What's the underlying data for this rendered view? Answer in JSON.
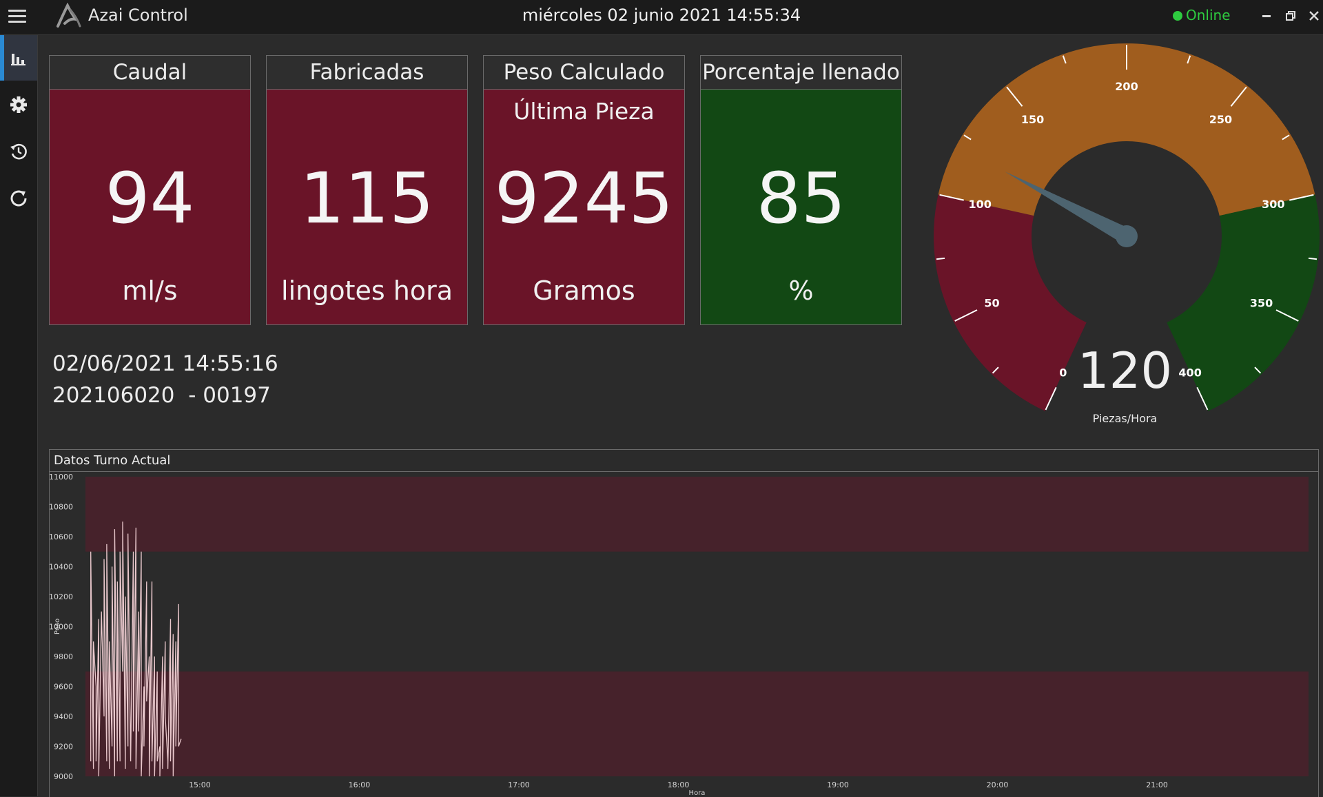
{
  "app": {
    "title": "Azai Control",
    "datetime": "miércoles 02 junio 2021 14:55:34",
    "status": "Online",
    "status_color": "#2ecc40"
  },
  "window_controls": {
    "icons": [
      "minimize-icon",
      "restore-icon",
      "close-icon"
    ]
  },
  "sidebar": {
    "items": [
      {
        "icon": "bar-chart-icon",
        "active": true
      },
      {
        "icon": "gear-icon",
        "active": false
      },
      {
        "icon": "history-icon",
        "active": false
      },
      {
        "icon": "refresh-icon",
        "active": false
      }
    ]
  },
  "tiles": [
    {
      "title": "Caudal",
      "subtitle": "",
      "value": "94",
      "unit": "ml/s",
      "color": "#6a1428"
    },
    {
      "title": "Fabricadas",
      "subtitle": "",
      "value": "115",
      "unit": "lingotes hora",
      "color": "#6a1428"
    },
    {
      "title": "Peso Calculado",
      "subtitle": "Última Pieza",
      "value": "9245",
      "unit": "Gramos",
      "color": "#6a1428"
    },
    {
      "title": "Porcentaje llenado",
      "subtitle": "",
      "value": "85",
      "unit": "%",
      "color": "#124814"
    }
  ],
  "info": {
    "timestamp": "02/06/2021 14:55:16",
    "lot": "202106020  - 00197"
  },
  "gauge": {
    "value": "120",
    "needle_value": 120,
    "unit": "Piezas/Hora",
    "min": 0,
    "max": 400,
    "major_labels": [
      "0",
      "50",
      "100",
      "150",
      "200",
      "250",
      "300",
      "350",
      "400"
    ],
    "bands": [
      {
        "from": 0,
        "to": 100,
        "color": "#6a1428"
      },
      {
        "from": 100,
        "to": 300,
        "color": "#a05d1e"
      },
      {
        "from": 300,
        "to": 400,
        "color": "#124814"
      }
    ]
  },
  "chart_panel": {
    "title": "Datos Turno Actual"
  },
  "chart_data": {
    "type": "line",
    "title": "Datos Turno Actual",
    "xlabel": "Hora",
    "ylabel": "Peso",
    "ylim": [
      9000,
      11000
    ],
    "xlim": [
      "14:17",
      "21:57"
    ],
    "yticks": [
      "11000",
      "10800",
      "10600",
      "10400",
      "10200",
      "10000",
      "9800",
      "9600",
      "9400",
      "9200",
      "9000"
    ],
    "xticks": [
      "15:00",
      "16:00",
      "17:00",
      "18:00",
      "19:00",
      "20:00",
      "21:00"
    ],
    "bands": [
      {
        "from": 10500,
        "to": 11000,
        "color": "#46222b"
      },
      {
        "from": 9000,
        "to": 9700,
        "color": "#46222b"
      }
    ],
    "series": [
      {
        "color": "#e9c8cc",
        "x": [
          "14:19",
          "14:19",
          "14:20",
          "14:20",
          "14:21",
          "14:21",
          "14:22",
          "14:22",
          "14:23",
          "14:24",
          "14:24",
          "14:25",
          "14:25",
          "14:26",
          "14:26",
          "14:27",
          "14:27",
          "14:28",
          "14:28",
          "14:29",
          "14:29",
          "14:30",
          "14:30",
          "14:31",
          "14:31",
          "14:32",
          "14:32",
          "14:33",
          "14:33",
          "14:34",
          "14:35",
          "14:35",
          "14:36",
          "14:36",
          "14:37",
          "14:37",
          "14:38",
          "14:38",
          "14:39",
          "14:39",
          "14:40",
          "14:40",
          "14:41",
          "14:41",
          "14:42",
          "14:42",
          "14:43",
          "14:43",
          "14:44",
          "14:44",
          "14:45",
          "14:45",
          "14:46",
          "14:46",
          "14:47",
          "14:47",
          "14:48",
          "14:48",
          "14:49",
          "14:49",
          "14:50",
          "14:50",
          "14:51",
          "14:51",
          "14:52",
          "14:52",
          "14:53"
        ],
        "y": [
          9100,
          10500,
          9050,
          9900,
          9600,
          9100,
          10050,
          9000,
          10100,
          9400,
          10450,
          9100,
          10550,
          9050,
          9900,
          9200,
          10400,
          9000,
          10650,
          9100,
          10300,
          9100,
          10500,
          9700,
          10700,
          9050,
          10200,
          9200,
          10620,
          9100,
          10500,
          9300,
          10660,
          9050,
          10100,
          9300,
          10500,
          9000,
          9600,
          9200,
          10300,
          9500,
          9800,
          9000,
          10300,
          9100,
          9800,
          9000,
          9700,
          9100,
          9200,
          9000,
          9800,
          9050,
          9900,
          9400,
          9100,
          9050,
          10050,
          9100,
          9950,
          9000,
          9900,
          9200,
          10150,
          9200,
          9250
        ]
      }
    ]
  }
}
